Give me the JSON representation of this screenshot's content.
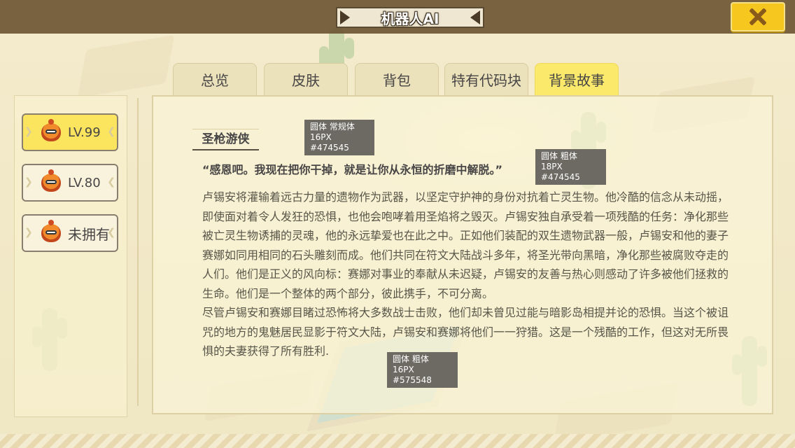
{
  "header": {
    "title": "机器人AI",
    "close_icon": "close-x-icon"
  },
  "tabs": [
    {
      "label": "总览"
    },
    {
      "label": "皮肤"
    },
    {
      "label": "背包"
    },
    {
      "label": "特有代码块"
    },
    {
      "label": "背景故事",
      "active": true
    }
  ],
  "levels": [
    {
      "label": "LV.99",
      "selected": true
    },
    {
      "label": "LV.80"
    },
    {
      "label": "未拥有"
    }
  ],
  "story": {
    "title": "圣枪游侠",
    "quote": "“感恩吧。我现在把你干掉，就是让你从永恒的折磨中解脱。”",
    "paragraphs": [
      "卢锡安将灌输着远古力量的遗物作为武器，以坚定守护神的身份对抗着亡灵生物。他冷酷的信念从未动摇，即使面对着令人发狂的恐惧，也他会咆哮着用圣焰将之毁灭。卢锡安独自承受着一项残酷的任务：净化那些被亡灵生物诱捕的灵魂，他的永远挚爱也在此之中。正如他们装配的双生遗物武器一般，卢锡安和他的妻子赛娜如同用相同的石头雕刻而成。他们共同在符文大陆战斗多年，将圣光带向黑暗，净化那些被腐败夺走的人们。他们是正义的风向标：赛娜对事业的奉献从未迟疑，卢锡安的友善与热心则感动了许多被他们拯救的生命。他们是一个整体的两个部分，彼此携手，不可分离。",
      "尽管卢锡安和赛娜目睹过恐怖将大多数战士击败，他们却未曾见过能与暗影岛相提并论的恐惧。当这个被诅咒的地方的鬼魅居民显影于符文大陆，卢锡安和赛娜将他们一一狩猎。这是一个残酷的工作，但这对无所畏惧的夫妻获得了所有胜利."
    ]
  },
  "annotations": [
    {
      "line1": "圆体 常规体",
      "line2": "16PX  #474545"
    },
    {
      "line1": "圆体 粗体",
      "line2": "18PX  #474545"
    },
    {
      "line1": "圆体 粗体",
      "line2": "16PX  #575548"
    }
  ],
  "colors": {
    "accent_yellow": "#fae96b",
    "close_button": "#f6c81f",
    "text_primary": "#474545",
    "text_body": "#575548"
  }
}
